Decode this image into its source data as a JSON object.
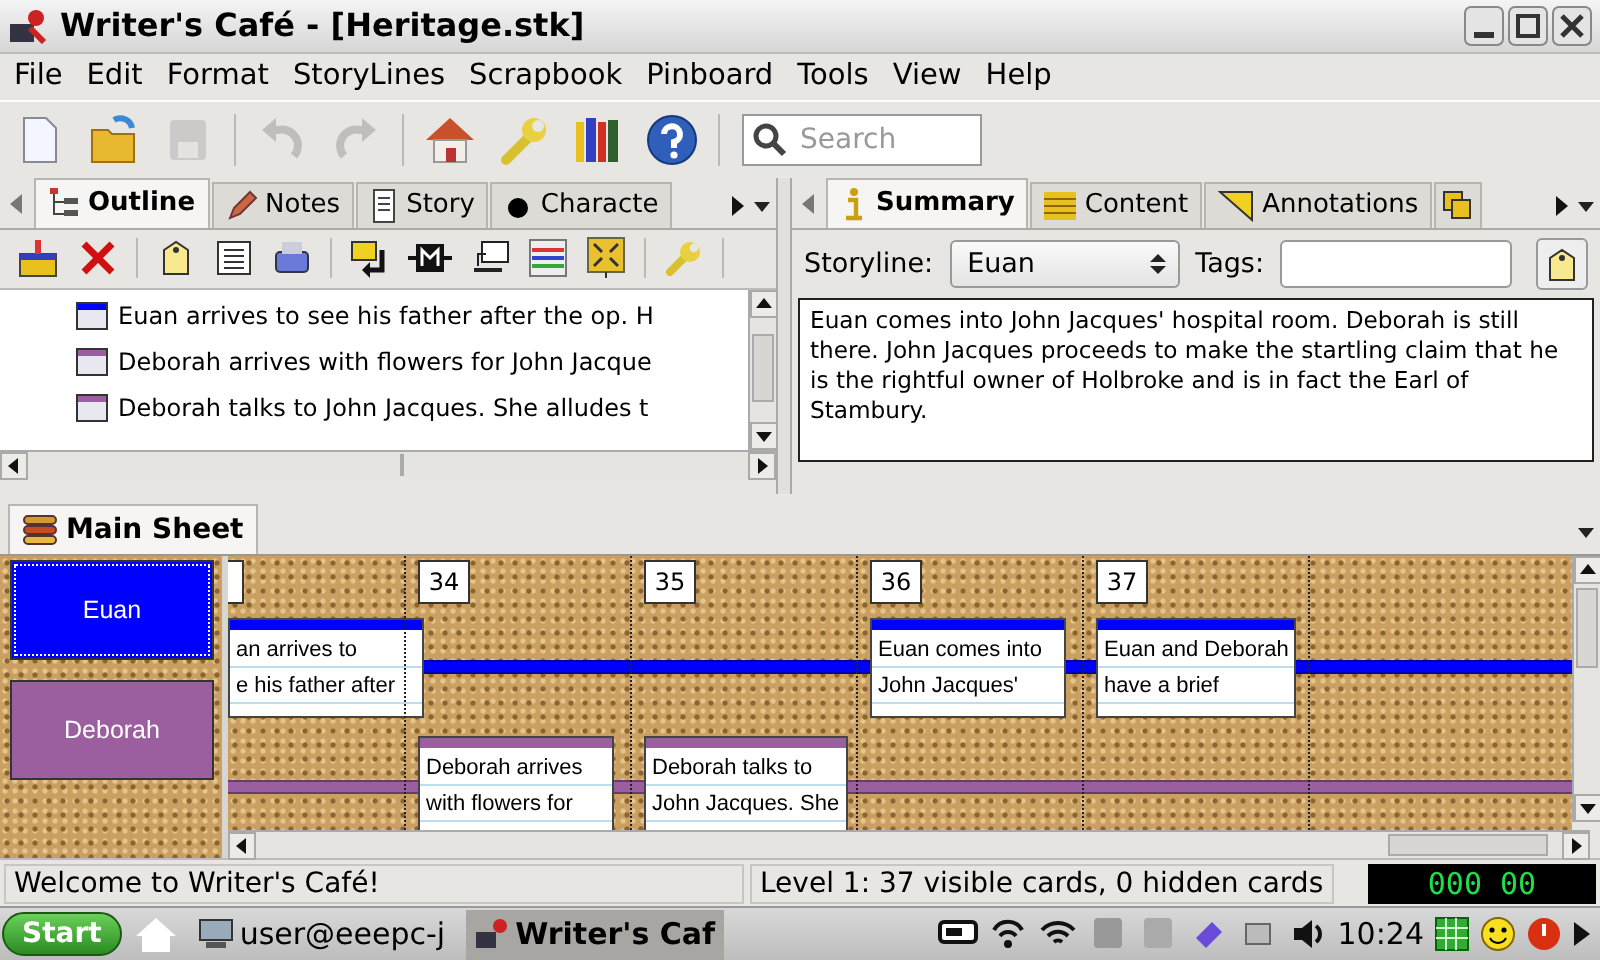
{
  "window": {
    "title": "Writer's Café - [Heritage.stk]"
  },
  "menus": [
    "File",
    "Edit",
    "Format",
    "StoryLines",
    "Scrapbook",
    "Pinboard",
    "Tools",
    "View",
    "Help"
  ],
  "toolbar": [
    {
      "kind": "new",
      "disabled": false
    },
    {
      "kind": "open",
      "disabled": false
    },
    {
      "kind": "save",
      "disabled": true
    },
    {
      "kind": "undo",
      "disabled": true
    },
    {
      "kind": "redo",
      "disabled": true
    },
    {
      "kind": "home",
      "disabled": false
    },
    {
      "kind": "settings",
      "disabled": false
    },
    {
      "kind": "library",
      "disabled": false
    },
    {
      "kind": "help",
      "disabled": false
    }
  ],
  "search": {
    "placeholder": "Search"
  },
  "left_pane": {
    "tabs": [
      {
        "label": "Outline",
        "selected": true
      },
      {
        "label": "Notes",
        "selected": false
      },
      {
        "label": "Story",
        "selected": false
      },
      {
        "label": "Characte",
        "selected": false
      }
    ],
    "outline": [
      {
        "text": "Euan arrives to see his father after the op. H",
        "color": "#0000ff"
      },
      {
        "text": "Deborah arrives with flowers for John Jacque",
        "color": "#9b5fa0"
      },
      {
        "text": "Deborah talks to John Jacques. She alludes t",
        "color": "#9b5fa0"
      }
    ]
  },
  "right_pane": {
    "tabs": [
      {
        "label": "Summary",
        "selected": true
      },
      {
        "label": "Content",
        "selected": false
      },
      {
        "label": "Annotations",
        "selected": false
      }
    ],
    "storyline_label": "Storyline:",
    "storyline_value": "Euan",
    "tags_label": "Tags:",
    "summary": "Euan comes into John Jacques' hospital room. Deborah is still there. John Jacques proceeds to make the startling claim that he is the rightful owner of Holbroke and is in fact the Earl of Stambury."
  },
  "main_sheet": {
    "tab": "Main Sheet",
    "storylines": [
      {
        "name": "Euan",
        "color": "#0000ff",
        "selected": true
      },
      {
        "name": "Deborah",
        "color": "#9b5fa0",
        "selected": false
      }
    ],
    "columns": [
      {
        "cards": [
          {
            "kind": "upper",
            "lines": [
              "an arrives to",
              "e his father after"
            ]
          }
        ]
      },
      {
        "number": "34",
        "cards": [
          {
            "kind": "lower",
            "lines": [
              "Deborah arrives",
              "with flowers for"
            ]
          }
        ]
      },
      {
        "number": "35",
        "cards": [
          {
            "kind": "lower",
            "lines": [
              "Deborah talks to",
              "John Jacques. She"
            ]
          }
        ]
      },
      {
        "number": "36",
        "cards": [
          {
            "kind": "upper",
            "lines": [
              "Euan comes into",
              "John Jacques'"
            ]
          }
        ]
      },
      {
        "number": "37",
        "cards": [
          {
            "kind": "upper",
            "lines": [
              "Euan and Deborah",
              "have a brief"
            ]
          }
        ]
      }
    ]
  },
  "status_bar": {
    "message": "Welcome to Writer's Café!",
    "info": "Level 1: 37 visible cards, 0 hidden cards",
    "timer": "000 00"
  },
  "taskbar": {
    "start": "Start",
    "tasks": [
      {
        "label": "user@eeepc-j",
        "selected": false
      },
      {
        "label": "Writer's Caf",
        "selected": true
      }
    ],
    "clock": "10:24"
  }
}
